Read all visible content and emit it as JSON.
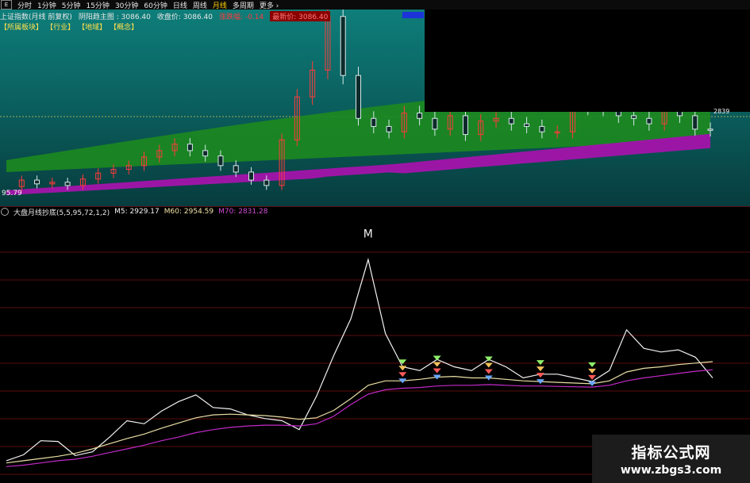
{
  "toolbar": {
    "first": "E",
    "items": [
      "分时",
      "1分钟",
      "5分钟",
      "15分钟",
      "30分钟",
      "60分钟",
      "日线",
      "周线",
      "月线",
      "多周期",
      "更多"
    ],
    "active": "月线"
  },
  "header": {
    "title": "上证指数(月线 前复权)",
    "main_chart_label": "阴阳趋主图",
    "main_chart_value": "3086.40",
    "close_label": "收盘价",
    "close_value": "3086.40",
    "change_label": "涨跌幅",
    "change_value": "-0.14",
    "extra_label": "最新价",
    "extra_value": "3086.40"
  },
  "sectors": [
    "所属板块",
    "行业",
    "地域",
    "概念"
  ],
  "price_labels": {
    "low": "95.79",
    "right": "2839"
  },
  "indicator": {
    "name": "大盘月线抄底(5,5,95,72,1,2)",
    "m5_label": "M5",
    "m5_value": "2929.17",
    "m60_label": "M60",
    "m60_value": "2954.59",
    "m70_label": "M70",
    "m70_value": "2831.28",
    "peak_marker": "M"
  },
  "watermark": {
    "title": "指标公式网",
    "url": "www.zbgs3.com"
  },
  "colors": {
    "up": "#ff3b3b",
    "down": "#0e2a2a",
    "band_green": "#1d8a1f",
    "band_purple": "#9c16a6",
    "m5": "#f2f2f2",
    "m60": "#e9dfa5",
    "m70": "#c22ac8",
    "grid_red": "#5a0d0d"
  },
  "chart_data": [
    {
      "type": "line",
      "title": "上证指数(月线 前复权)",
      "series": [
        {
          "name": "收盘价",
          "values": [
            2030,
            2150,
            2080,
            2110,
            2050,
            2170,
            2280,
            2350,
            2420,
            2580,
            2700,
            2820,
            2700,
            2600,
            2420,
            2300,
            2150,
            2050,
            2900,
            3700,
            4200,
            5200,
            4100,
            3300,
            3150,
            3050,
            3400,
            3300,
            3100,
            3350,
            3000,
            3250,
            3300,
            3200,
            3150,
            3050,
            3050,
            3700,
            3500,
            3480,
            3350,
            3300,
            3200,
            3450,
            3350,
            3100,
            3086
          ]
        }
      ]
    },
    {
      "type": "line",
      "title": "大盘月线抄底(5,5,95,72,1,2)",
      "series": [
        {
          "name": "M5",
          "values": [
            1980,
            2060,
            2250,
            2240,
            2050,
            2100,
            2300,
            2520,
            2480,
            2650,
            2780,
            2870,
            2700,
            2680,
            2600,
            2550,
            2520,
            2400,
            2850,
            3400,
            3900,
            4700,
            3700,
            3250,
            3200,
            3350,
            3250,
            3200,
            3350,
            3250,
            3100,
            3150,
            3150,
            3100,
            3050,
            3200,
            3750,
            3500,
            3450,
            3480,
            3380,
            3100
          ]
        },
        {
          "name": "M60",
          "values": [
            1950,
            1980,
            2010,
            2040,
            2080,
            2140,
            2210,
            2280,
            2340,
            2420,
            2490,
            2560,
            2600,
            2610,
            2600,
            2590,
            2570,
            2540,
            2560,
            2660,
            2820,
            3000,
            3060,
            3060,
            3080,
            3110,
            3120,
            3100,
            3100,
            3080,
            3060,
            3050,
            3040,
            3030,
            3020,
            3060,
            3180,
            3230,
            3250,
            3280,
            3300,
            3320
          ]
        },
        {
          "name": "M70",
          "values": [
            1900,
            1920,
            1950,
            1980,
            2000,
            2040,
            2090,
            2140,
            2190,
            2250,
            2300,
            2360,
            2400,
            2430,
            2450,
            2460,
            2460,
            2450,
            2480,
            2580,
            2740,
            2880,
            2940,
            2960,
            2970,
            2990,
            3000,
            3000,
            3010,
            3000,
            2990,
            2990,
            2985,
            2980,
            2975,
            3000,
            3060,
            3100,
            3130,
            3160,
            3190,
            3210
          ]
        }
      ]
    }
  ]
}
